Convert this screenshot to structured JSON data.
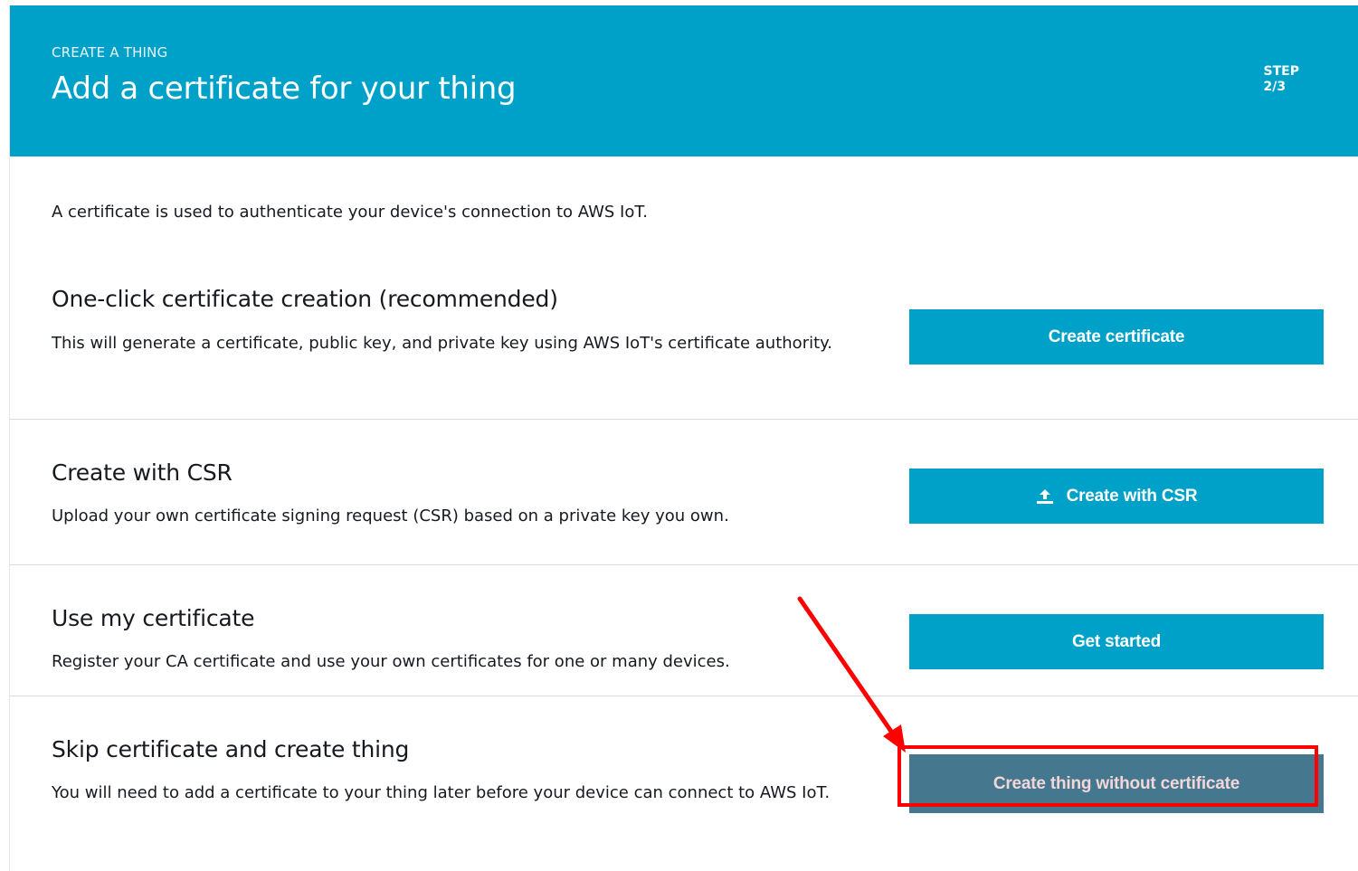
{
  "header": {
    "eyebrow": "CREATE A THING",
    "title": "Add a certificate for your thing",
    "step_label": "STEP",
    "step_value": "2/3"
  },
  "intro": "A certificate is used to authenticate your device's connection to AWS IoT.",
  "sections": [
    {
      "title": "One-click certificate creation (recommended)",
      "description": "This will generate a certificate, public key, and private key using AWS IoT's certificate authority.",
      "button_label": "Create certificate"
    },
    {
      "title": "Create with CSR",
      "description": "Upload your own certificate signing request (CSR) based on a private key you own.",
      "button_label": "Create with CSR",
      "button_icon": "upload-icon"
    },
    {
      "title": "Use my certificate",
      "description": "Register your CA certificate and use your own certificates for one or many devices.",
      "button_label": "Get started"
    },
    {
      "title": "Skip certificate and create thing",
      "description": "You will need to add a certificate to your thing later before your device can connect to AWS IoT.",
      "button_label": "Create thing without certificate"
    }
  ],
  "colors": {
    "header_bg": "#00a1c9",
    "button_bg": "#00a1c9",
    "button_muted_bg": "#45788f",
    "annotation": "#ff0000"
  }
}
